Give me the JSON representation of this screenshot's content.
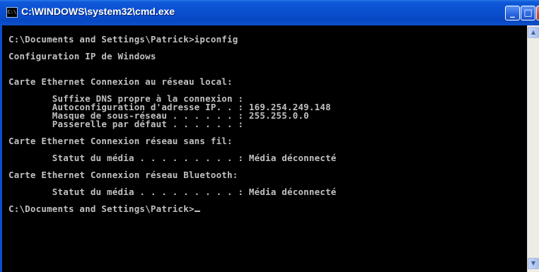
{
  "window": {
    "title": "C:\\WINDOWS\\system32\\cmd.exe",
    "icon": "cmd-icon",
    "icon_text": "C:\\",
    "buttons": {
      "minimize": "_",
      "maximize": "□",
      "close": "×"
    }
  },
  "console": {
    "lines": [
      "C:\\Documents and Settings\\Patrick>ipconfig",
      "",
      "Configuration IP de Windows",
      "",
      "",
      "Carte Ethernet Connexion au réseau local:",
      "",
      "        Suffixe DNS propre à la connexion :",
      "        Autoconfiguration d'adresse IP. . : 169.254.249.148",
      "        Masque de sous-réseau . . . . . . : 255.255.0.0",
      "        Passerelle par défaut . . . . . . :",
      "",
      "Carte Ethernet Connexion réseau sans fil:",
      "",
      "        Statut du média . . . . . . . . . : Média déconnecté",
      "",
      "Carte Ethernet Connexion réseau Bluetooth:",
      "",
      "        Statut du média . . . . . . . . . : Média déconnecté",
      "",
      "C:\\Documents and Settings\\Patrick>"
    ]
  },
  "scrollbar": {
    "up_icon": "▲",
    "down_icon": "▼"
  },
  "colors": {
    "console_bg": "#000000",
    "console_text": "#c0c0c0",
    "titlebar": "#0a4fd0"
  }
}
